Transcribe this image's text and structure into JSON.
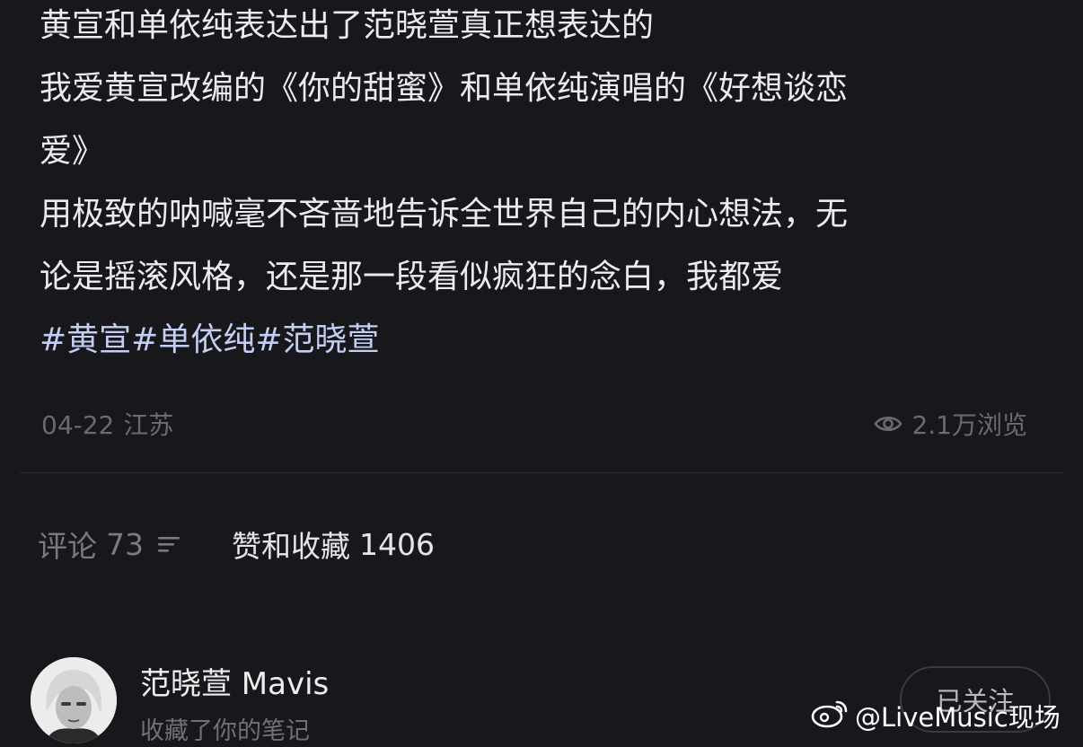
{
  "post": {
    "lines": [
      "黄宣和单依纯表达出了范晓萱真正想表达的",
      "我爱黄宣改编的《你的甜蜜》和单依纯演唱的《好想谈恋",
      "爱》",
      "用极致的呐喊毫不吝啬地告诉全世界自己的内心想法，无",
      "论是摇滚风格，还是那一段看似疯狂的念白，我都爱"
    ],
    "hashtags": "#黄宣#单依纯#范晓萱"
  },
  "meta": {
    "date": "04-22",
    "location": "江苏",
    "views": "2.1万浏览",
    "views_icon": "eye-icon"
  },
  "tabs": {
    "comments_label": "评论",
    "comments_count": "73",
    "likes_label": "赞和收藏",
    "likes_count": "1406"
  },
  "user": {
    "name": "范晓萱 Mavis",
    "action": "收藏了你的笔记",
    "follow_label": "已关注"
  },
  "watermark": {
    "text": "@LiveMusic现场",
    "icon": "weibo-icon"
  },
  "colors": {
    "background": "#18171c",
    "hashtag": "#c4cef3",
    "muted": "#6a6a72"
  }
}
